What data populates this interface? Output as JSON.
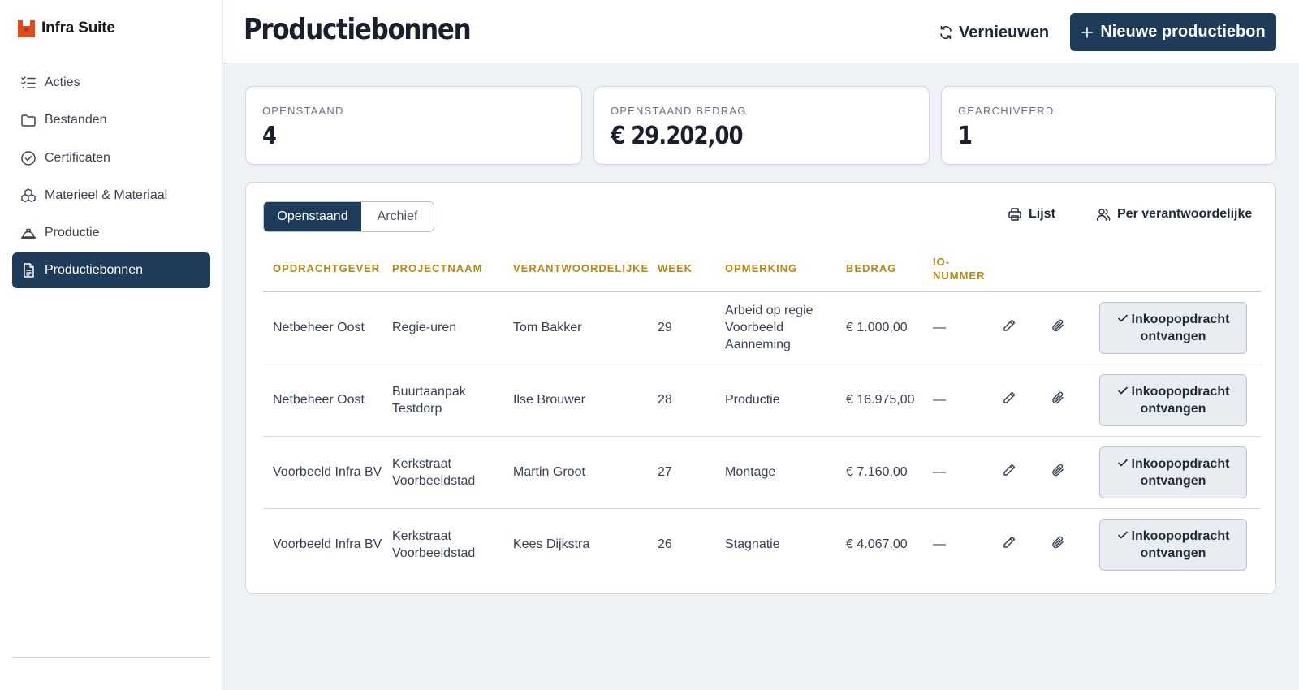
{
  "brand": {
    "name": "Infra Suite",
    "accent": "#e04a1f"
  },
  "sidebar": {
    "items": [
      {
        "label": "Acties",
        "icon": "checklist-icon",
        "active": false
      },
      {
        "label": "Bestanden",
        "icon": "folder-icon",
        "active": false
      },
      {
        "label": "Certificaten",
        "icon": "badge-check-icon",
        "active": false
      },
      {
        "label": "Materieel & Materiaal",
        "icon": "boxes-icon",
        "active": false
      },
      {
        "label": "Productie",
        "icon": "hardhat-icon",
        "active": false
      },
      {
        "label": "Productiebonnen",
        "icon": "document-icon",
        "active": true
      }
    ]
  },
  "header": {
    "title": "Productiebonnen",
    "refresh_label": "Vernieuwen",
    "new_label": "Nieuwe productiebon"
  },
  "stats": [
    {
      "label": "OPENSTAAND",
      "value": "4"
    },
    {
      "label": "OPENSTAAND BEDRAG",
      "value": "€ 29.202,00"
    },
    {
      "label": "GEARCHIVEERD",
      "value": "1"
    }
  ],
  "tabs": [
    {
      "label": "Openstaand",
      "active": true
    },
    {
      "label": "Archief",
      "active": false
    }
  ],
  "tools": {
    "list_label": "Lijst",
    "per_owner_label": "Per verantwoordelijke"
  },
  "table": {
    "columns": [
      "OPDRACHTGEVER",
      "PROJECTNAAM",
      "VERANTWOORDELIJKE",
      "WEEK",
      "OPMERKING",
      "BEDRAG",
      "IO-NUMMER"
    ],
    "rows": [
      {
        "client": "Netbeheer Oost",
        "project": "Regie-uren",
        "owner": "Tom Bakker",
        "week": "29",
        "note": "Arbeid op regie Voorbeeld Aanneming",
        "amount": "€ 1.000,00",
        "io": "—",
        "action": "Inkoopopdracht ontvangen"
      },
      {
        "client": "Netbeheer Oost",
        "project": "Buurtaanpak Testdorp",
        "owner": "Ilse Brouwer",
        "week": "28",
        "note": "Productie",
        "amount": "€ 16.975,00",
        "io": "—",
        "action": "Inkoopopdracht ontvangen"
      },
      {
        "client": "Voorbeeld Infra BV",
        "project": "Kerkstraat Voorbeeldstad",
        "owner": "Martin Groot",
        "week": "27",
        "note": "Montage",
        "amount": "€ 7.160,00",
        "io": "—",
        "action": "Inkoopopdracht ontvangen"
      },
      {
        "client": "Voorbeeld Infra BV",
        "project": "Kerkstraat Voorbeeldstad",
        "owner": "Kees Dijkstra",
        "week": "26",
        "note": "Stagnatie",
        "amount": "€ 4.067,00",
        "io": "—",
        "action": "Inkoopopdracht ontvangen"
      }
    ]
  },
  "colors": {
    "primary": "#1f3b5a",
    "header_accent": "#b58a12",
    "background": "#eef1f5"
  }
}
